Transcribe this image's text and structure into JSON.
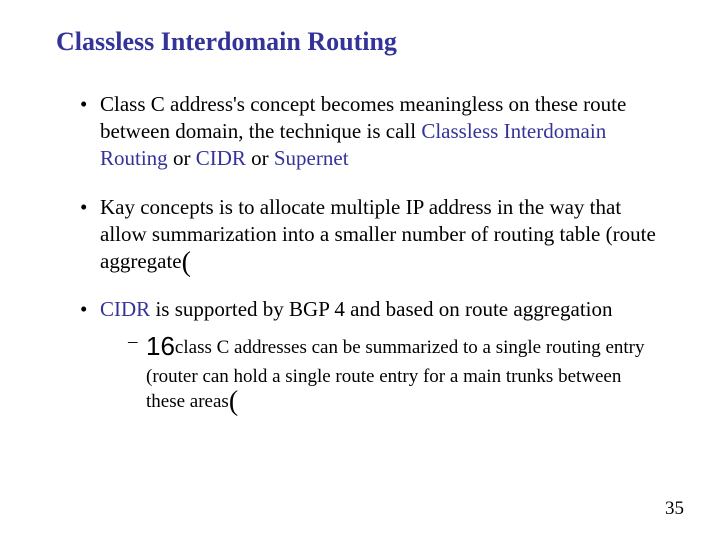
{
  "title": "Classless Interdomain Routing",
  "bullets": {
    "b1": {
      "t1": "Class C address's concept becomes meaningless on these route  between domain, the technique is call ",
      "hl1": "Classless Interdomain Routing",
      "t2": " or ",
      "hl2": "CIDR",
      "t3": " or ",
      "hl3": "Supernet"
    },
    "b2": {
      "t1": "Kay concepts is to allocate multiple IP address in the way that allow summarization into a smaller number of routing table (route aggregate",
      "paren": "("
    },
    "b3": {
      "hl1": "CIDR",
      "t1": " is supported by BGP 4 and based on route aggregation",
      "sub1": {
        "big": "16",
        "t1": "class C addresses can be summarized to a single routing entry (router can hold a single route entry for a main trunks between these areas",
        "paren": "("
      }
    }
  },
  "pagenum": "35"
}
